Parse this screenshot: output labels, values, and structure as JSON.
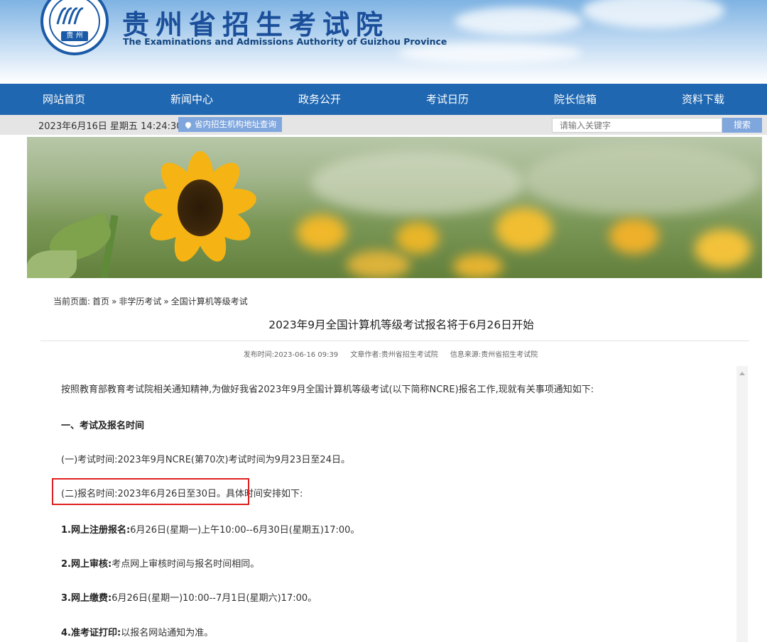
{
  "header": {
    "logo_tag": "贵 州",
    "title_cn": "贵州省招生考试院",
    "title_en": "The Examinations and Admissions Authority of Guizhou Province"
  },
  "nav": {
    "items": [
      {
        "label": "网站首页"
      },
      {
        "label": "新闻中心"
      },
      {
        "label": "政务公开"
      },
      {
        "label": "考试日历"
      },
      {
        "label": "院长信箱"
      },
      {
        "label": "资料下载"
      }
    ]
  },
  "infobar": {
    "datetime": "2023年6月16日 星期五 14:24:30",
    "address_link": "省内招生机构地址查询",
    "search_placeholder": "请输入关键字",
    "search_button": "搜索"
  },
  "breadcrumb": {
    "prefix": "当前页面:",
    "items": [
      "首页",
      "»",
      "非学历考试",
      "»",
      "全国计算机等级考试"
    ]
  },
  "article": {
    "title": "2023年9月全国计算机等级考试报名将于6月26日开始",
    "publish_time": "发布时间:2023-06-16 09:39",
    "author": "文章作者:贵州省招生考试院",
    "source": "信息来源:贵州省招生考试院",
    "intro": "按照教育部教育考试院相关通知精神,为做好我省2023年9月全国计算机等级考试(以下简称NCRE)报名工作,现就有关事项通知如下:",
    "section1": "一、考试及报名时间",
    "item1": "(一)考试时间:2023年9月NCRE(第70次)考试时间为9月23日至24日。",
    "item2a": "(二)报名时间:2023年6月26日至30日。",
    "item2b": "具体时间安排如下:",
    "step1_label": "1.网上注册报名:",
    "step1_text": "6月26日(星期一)上午10:00--6月30日(星期五)17:00。",
    "step2_label": "2.网上审核:",
    "step2_text": "考点网上审核时间与报名时间相同。",
    "step3_label": "3.网上缴费:",
    "step3_text": "6月26日(星期一)10:00--7月1日(星期六)17:00。",
    "step4_label": "4.准考证打印:",
    "step4_text": "以报名网站通知为准。"
  },
  "colors": {
    "nav_bg": "#1f67b1",
    "highlight": "#e02020",
    "title_blue": "#1b4f9a",
    "search_btn": "#7fa6dd"
  }
}
